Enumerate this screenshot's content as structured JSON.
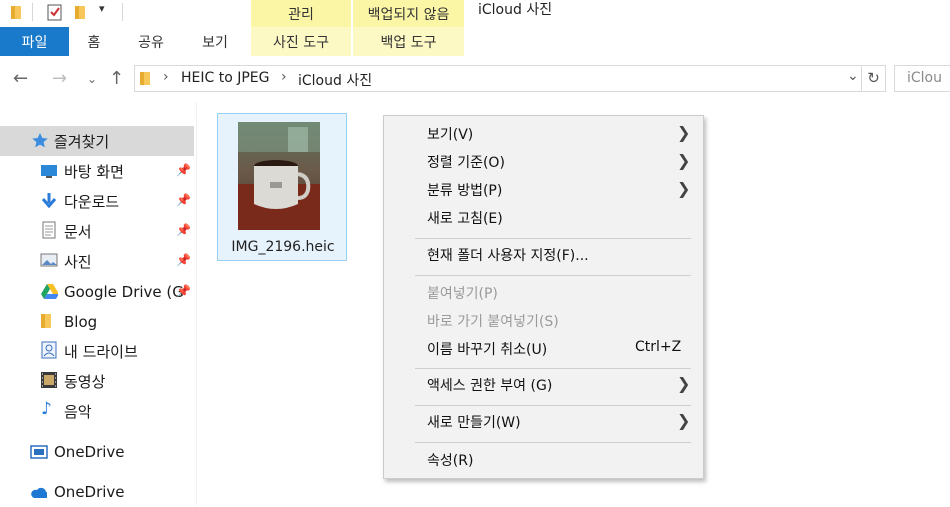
{
  "ribbon": {
    "context_tab_manage": "관리",
    "context_tab_backup": "백업되지 않음",
    "window_title": "iCloud 사진",
    "tabs": {
      "file": "파일",
      "home": "홈",
      "share": "공유",
      "view": "보기",
      "photo_tools": "사진 도구",
      "backup_tools": "백업 도구"
    }
  },
  "address": {
    "crumbs": [
      "HEIC to JPEG",
      "iCloud 사진"
    ],
    "search_placeholder": "iClou"
  },
  "nav": {
    "quick_access": "즐겨찾기",
    "items": [
      {
        "label": "바탕 화면",
        "icon": "desktop-icon",
        "pinned": true
      },
      {
        "label": "다운로드",
        "icon": "download-icon",
        "pinned": true
      },
      {
        "label": "문서",
        "icon": "document-icon",
        "pinned": true
      },
      {
        "label": "사진",
        "icon": "picture-icon",
        "pinned": true
      },
      {
        "label": "Google Drive (G",
        "icon": "google-drive-icon",
        "pinned": true
      },
      {
        "label": "Blog",
        "icon": "folder-icon",
        "pinned": false
      },
      {
        "label": "내 드라이브",
        "icon": "drive-icon",
        "pinned": false
      },
      {
        "label": "동영상",
        "icon": "video-icon",
        "pinned": false
      },
      {
        "label": "음악",
        "icon": "music-icon",
        "pinned": false
      }
    ],
    "onedrive_1": "OneDrive",
    "onedrive_2": "OneDrive"
  },
  "file": {
    "name": "IMG_2196.heic"
  },
  "context_menu": {
    "view": "보기(V)",
    "sort_by": "정렬 기준(O)",
    "group_by": "분류 방법(P)",
    "refresh": "새로 고침(E)",
    "customize": "현재 폴더 사용자 지정(F)...",
    "paste": "붙여넣기(P)",
    "paste_shortcut": "바로 가기 붙여넣기(S)",
    "undo_rename": "이름 바꾸기 취소(U)",
    "undo_shortcut": "Ctrl+Z",
    "give_access": "액세스 권한 부여 (G)",
    "new": "새로 만들기(W)",
    "properties": "속성(R)"
  },
  "colors": {
    "file_tab": "#1979ca",
    "context_tab": "#fbf6a6",
    "selection": "#e6f2fc",
    "menu_bg": "#f2f2f2"
  }
}
